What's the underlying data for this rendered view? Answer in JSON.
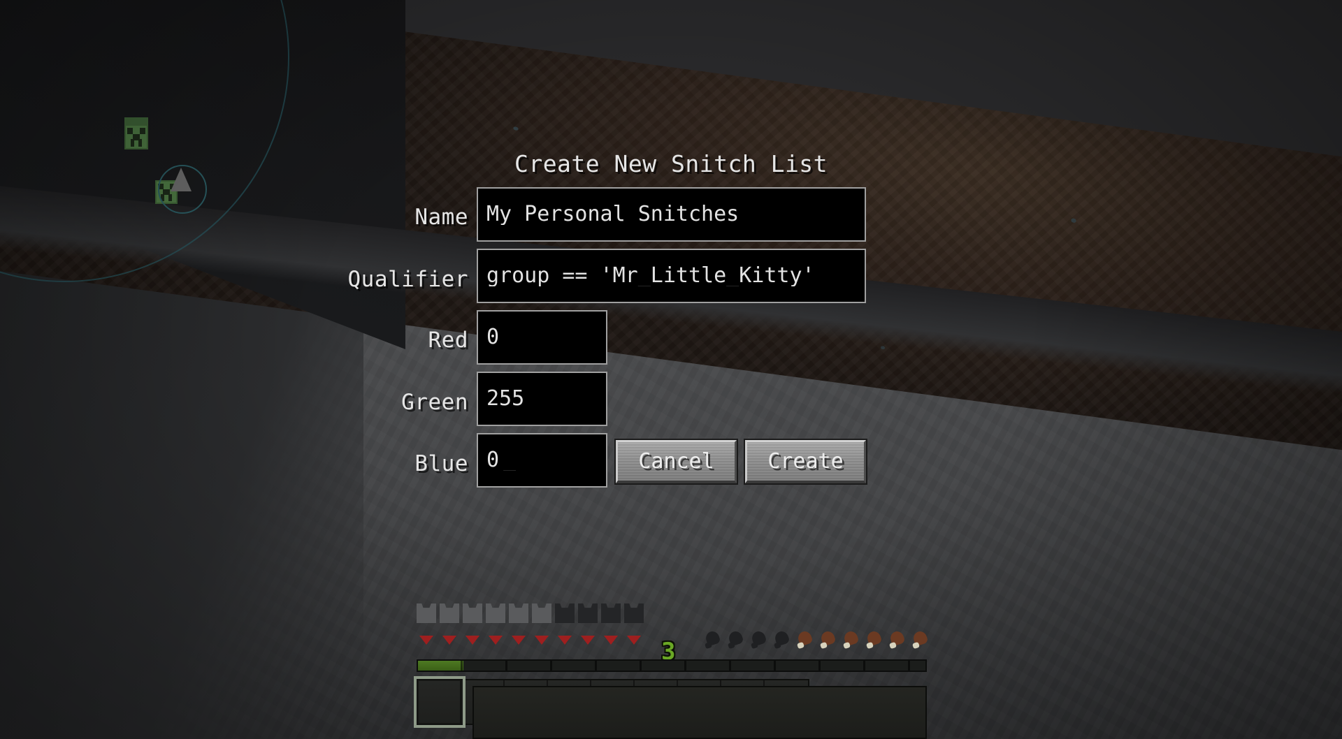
{
  "window": {
    "app": "Minecraft",
    "scene": "underground-cave"
  },
  "dialog": {
    "title": "Create New Snitch List",
    "fields": [
      {
        "label": "Name",
        "value": "My Personal Snitches",
        "name": "name"
      },
      {
        "label": "Qualifier",
        "value": "group == 'Mr_Little_Kitty'",
        "name": "qualifier"
      },
      {
        "label": "Red",
        "value": "0",
        "name": "red"
      },
      {
        "label": "Green",
        "value": "255",
        "name": "green"
      },
      {
        "label": "Blue",
        "value": "0",
        "name": "blue"
      }
    ],
    "focused_field": "blue",
    "caret": "_",
    "buttons": [
      {
        "label": "Cancel",
        "name": "cancel"
      },
      {
        "label": "Create",
        "name": "create"
      }
    ]
  },
  "hud": {
    "armor": {
      "total": 10,
      "filled": 6
    },
    "health": {
      "total_hearts": 10,
      "full_hearts": 10
    },
    "hunger": {
      "total": 10,
      "filled": 6
    },
    "xp_level": "3",
    "xp_progress_percent": 9,
    "hotbar": {
      "slots": 9,
      "selected_index": 0
    }
  },
  "entities": {
    "creepers": 2,
    "marker": "waypoint-arrow"
  },
  "colors": {
    "field_border": "#a0a0a0",
    "field_background": "#000000",
    "text": "#e6e6e6",
    "button_face": "#8e8e8e",
    "xp_green": "#6aa825",
    "heart_red": "#9e1f1f",
    "marker_teal": "#2b5d64",
    "creeper_green": "#4e7a44"
  }
}
